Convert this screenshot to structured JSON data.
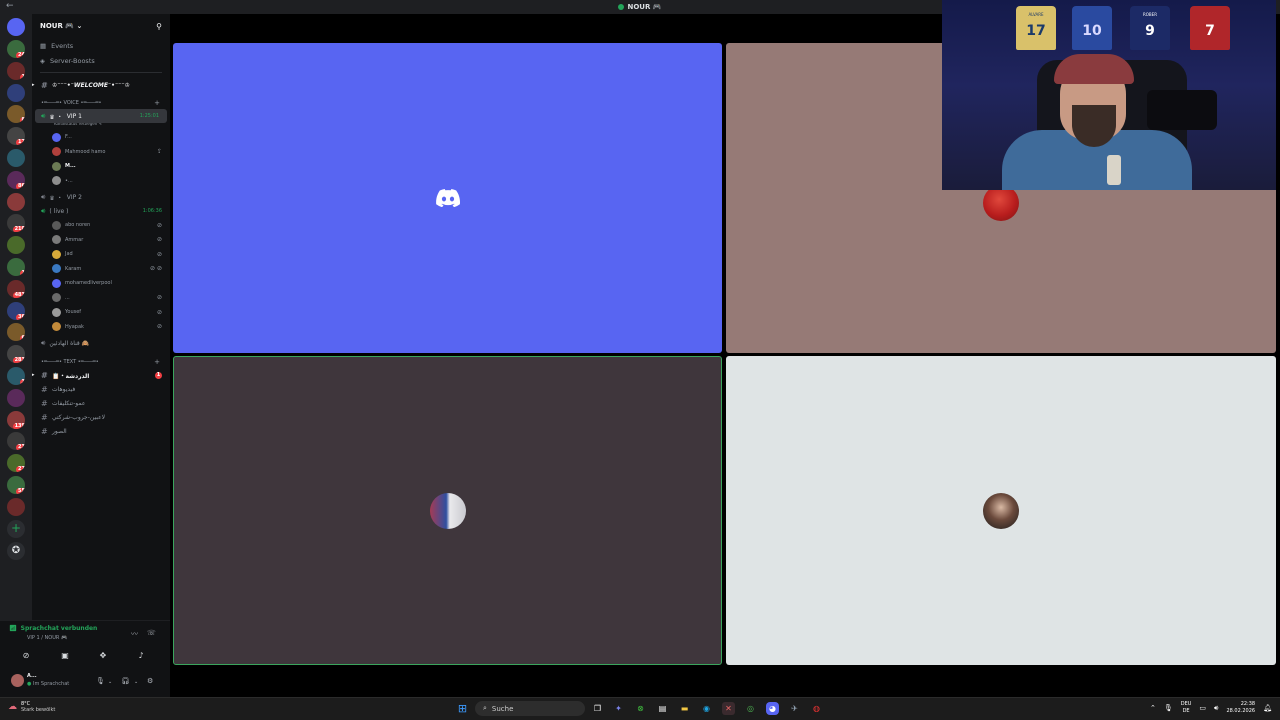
{
  "titlebar": {
    "title": "NOUR 🎮"
  },
  "server": {
    "name": "NOUR 🎮",
    "links": [
      "Events",
      "Server-Boosts"
    ],
    "welcome_channel": "♔︎⁻⁻⁻•⁻WELCOME⁻•⁻⁻⁻♔︎",
    "voice_category": "•═───═• VOICE •═───═•",
    "vip1": {
      "name": "VIP 1",
      "sub": "Kanalstatus festlegen",
      "timer": "1:25:01"
    },
    "vip1_users": [
      "F...",
      "Mahmood hamo",
      "M...",
      "•..."
    ],
    "vip2": {
      "name": "VIP 2"
    },
    "live": {
      "name": "( live )",
      "timer": "1:06:36"
    },
    "live_users": [
      "abo noren",
      "Ammar",
      "Jad",
      "Karam",
      "mohamedliverpool",
      "...",
      "Yousef",
      "Hyapak"
    ],
    "extra_voice": "قناة الهادئين 🙈",
    "text_category": "•═───═• TEXT •═───═•",
    "text_channels": [
      "📋・الدردشة",
      "فيديوهات",
      "عمو-تنكليفات",
      "لاعبين-جروب-شركتي",
      "الصور"
    ],
    "unread_count": "1"
  },
  "voicepanel": {
    "status": "Sprachchat verbunden",
    "where": "VIP 1 / NOUR 🎮"
  },
  "userpanel": {
    "name": "A...",
    "status": "Im Sprachchat"
  },
  "rail_badges": [
    "24",
    "1",
    "",
    "8",
    "17",
    "",
    "86",
    "",
    "210",
    "",
    "1",
    "483",
    "36",
    "6",
    "283",
    "3",
    "",
    "139",
    "23",
    "27",
    "55",
    "",
    "221",
    "188"
  ],
  "webcam": {
    "jersey_numbers": [
      "17",
      "10",
      "9",
      "7"
    ],
    "jersey_names": [
      "ALVARE",
      "",
      "ROBER",
      ""
    ]
  },
  "taskbar": {
    "weather_temp": "8°C",
    "weather_desc": "Stark bewölkt",
    "search_placeholder": "Suche",
    "lang1": "DEU",
    "lang2": "DE",
    "time": "22:38",
    "date": "28.02.2026"
  },
  "colors": {
    "discord_blurple": "#5865f2",
    "tile2": "#967a76",
    "tile3": "#3f363c",
    "tile4": "#dfe4e5",
    "speaking": "#3ba55d",
    "badge_red": "#f23f43"
  }
}
